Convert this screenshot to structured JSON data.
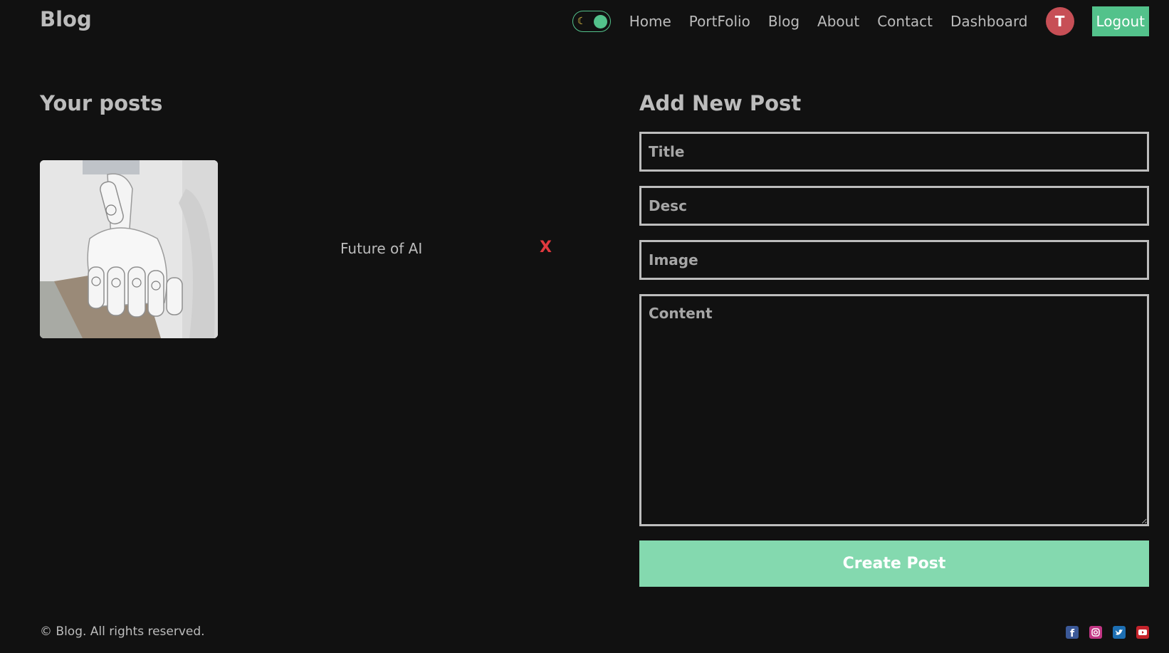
{
  "header": {
    "logo": "Blog",
    "nav": {
      "home": "Home",
      "portfolio": "PortFolio",
      "blog": "Blog",
      "about": "About",
      "contact": "Contact",
      "dashboard": "Dashboard"
    },
    "avatar_initial": "T",
    "logout_label": "Logout",
    "theme_toggle_icon": "moon-icon"
  },
  "posts": {
    "heading": "Your posts",
    "items": [
      {
        "title": "Future of AI",
        "delete_label": "X",
        "image_icon": "robot-hand-image"
      }
    ]
  },
  "form": {
    "heading": "Add New Post",
    "title_placeholder": "Title",
    "desc_placeholder": "Desc",
    "image_placeholder": "Image",
    "content_placeholder": "Content",
    "submit_label": "Create Post"
  },
  "footer": {
    "copyright": "© Blog. All rights reserved.",
    "socials": [
      "facebook-icon",
      "instagram-icon",
      "twitter-icon",
      "youtube-icon"
    ]
  },
  "colors": {
    "background": "#111111",
    "text": "#bcbcbc",
    "accent": "#53c28b",
    "button": "#84d9af",
    "avatar": "#c74f56",
    "delete": "#e0393e"
  }
}
